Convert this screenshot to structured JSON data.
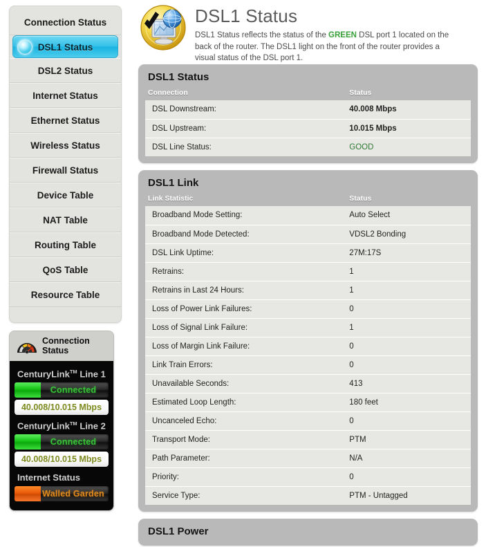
{
  "sidebar": {
    "items": [
      {
        "label": "Connection Status",
        "active": false
      },
      {
        "label": "DSL1 Status",
        "active": true
      },
      {
        "label": "DSL2 Status",
        "active": false
      },
      {
        "label": "Internet Status",
        "active": false
      },
      {
        "label": "Ethernet Status",
        "active": false
      },
      {
        "label": "Wireless Status",
        "active": false
      },
      {
        "label": "Firewall Status",
        "active": false
      },
      {
        "label": "Device Table",
        "active": false
      },
      {
        "label": "NAT Table",
        "active": false
      },
      {
        "label": "Routing Table",
        "active": false
      },
      {
        "label": "QoS Table",
        "active": false
      },
      {
        "label": "Resource Table",
        "active": false
      }
    ]
  },
  "connection_widget": {
    "title_line1": "Connection",
    "title_line2": "Status",
    "icon": "gauge-icon",
    "entries": [
      {
        "label_brand": "CenturyLink",
        "label_tm": "TM",
        "label_suffix": "Line 1",
        "state": "Connected",
        "state_color": "#39c339",
        "led_color": "#15c215",
        "speed": "40.008/10.015 Mbps"
      },
      {
        "label_brand": "CenturyLink",
        "label_tm": "TM",
        "label_suffix": "Line 2",
        "state": "Connected",
        "state_color": "#39c339",
        "led_color": "#15c215",
        "speed": "40.008/10.015 Mbps"
      }
    ],
    "internet": {
      "label": "Internet Status",
      "state": "Walled Garden",
      "state_color": "#e08a1e",
      "led_color": "#e95a08"
    }
  },
  "header": {
    "icon": "status-monitor-globe-check-icon",
    "title": "DSL1 Status",
    "desc_part1": "DSL1 Status reflects the status of the ",
    "desc_highlight": "GREEN",
    "desc_part2": " DSL port 1 located on the back of the router. The DSL1 light on the front of the router provides a visual status of the DSL port 1.",
    "highlight_color": "#3aa03a"
  },
  "panels": [
    {
      "title": "DSL1 Status",
      "columns": [
        "Connection",
        "Status"
      ],
      "rows": [
        {
          "label": "DSL Downstream:",
          "value": "40.008 Mbps",
          "bold": true,
          "good": false
        },
        {
          "label": "DSL Upstream:",
          "value": "10.015 Mbps",
          "bold": true,
          "good": false
        },
        {
          "label": "DSL Line Status:",
          "value": "GOOD",
          "bold": false,
          "good": true
        }
      ]
    },
    {
      "title": "DSL1 Link",
      "columns": [
        "Link Statistic",
        "Status"
      ],
      "rows": [
        {
          "label": "Broadband Mode Setting:",
          "value": "Auto Select",
          "bold": false,
          "good": false
        },
        {
          "label": "Broadband Mode Detected:",
          "value": "VDSL2 Bonding",
          "bold": false,
          "good": false
        },
        {
          "label": "DSL Link Uptime:",
          "value": "27M:17S",
          "bold": false,
          "good": false
        },
        {
          "label": "Retrains:",
          "value": "1",
          "bold": false,
          "good": false
        },
        {
          "label": "Retrains in Last 24 Hours:",
          "value": "1",
          "bold": false,
          "good": false
        },
        {
          "label": "Loss of Power Link Failures:",
          "value": "0",
          "bold": false,
          "good": false
        },
        {
          "label": "Loss of Signal Link Failure:",
          "value": "1",
          "bold": false,
          "good": false
        },
        {
          "label": "Loss of Margin Link Failure:",
          "value": "0",
          "bold": false,
          "good": false
        },
        {
          "label": "Link Train Errors:",
          "value": "0",
          "bold": false,
          "good": false
        },
        {
          "label": "Unavailable Seconds:",
          "value": "413",
          "bold": false,
          "good": false
        },
        {
          "label": "Estimated Loop Length:",
          "value": "180 feet",
          "bold": false,
          "good": false
        },
        {
          "label": "Uncanceled Echo:",
          "value": "0",
          "bold": false,
          "good": false
        },
        {
          "label": "Transport Mode:",
          "value": "PTM",
          "bold": false,
          "good": false
        },
        {
          "label": "Path Parameter:",
          "value": "N/A",
          "bold": false,
          "good": false
        },
        {
          "label": "Priority:",
          "value": "0",
          "bold": false,
          "good": false
        },
        {
          "label": "Service Type:",
          "value": "PTM - Untagged",
          "bold": false,
          "good": false
        }
      ]
    },
    {
      "title": "DSL1 Power",
      "columns": [],
      "rows": []
    }
  ]
}
